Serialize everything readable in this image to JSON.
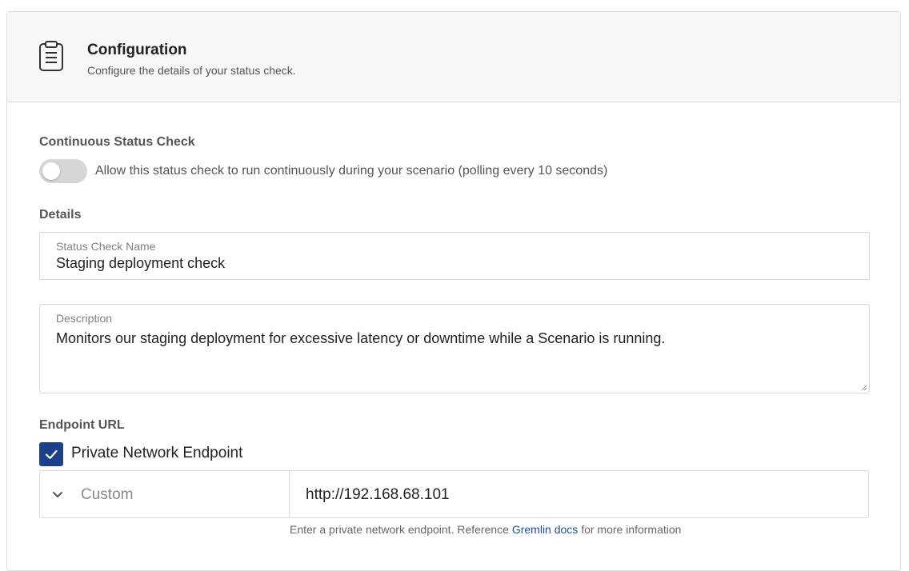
{
  "header": {
    "title": "Configuration",
    "subtitle": "Configure the details of your status check.",
    "icon": "clipboard-icon"
  },
  "continuous": {
    "label": "Continuous Status Check",
    "toggle_enabled": false,
    "toggle_text": "Allow this status check to run continuously during your scenario (polling every 10 seconds)"
  },
  "details": {
    "label": "Details",
    "name_label": "Status Check Name",
    "name_value": "Staging deployment check",
    "description_label": "Description",
    "description_value": "Monitors our staging deployment for excessive latency or downtime while a Scenario is running."
  },
  "endpoint": {
    "label": "Endpoint URL",
    "private_checked": true,
    "private_label": "Private Network Endpoint",
    "type_value": "Custom",
    "url_value": "http://192.168.68.101",
    "help_prefix": "Enter a private network endpoint. Reference",
    "help_link": "Gremlin docs",
    "help_suffix": "for more information"
  },
  "colors": {
    "accent": "#1c3f8c",
    "link": "#1f4f9c",
    "header_bg": "#f7f7f7",
    "border": "#dcdcdc"
  }
}
